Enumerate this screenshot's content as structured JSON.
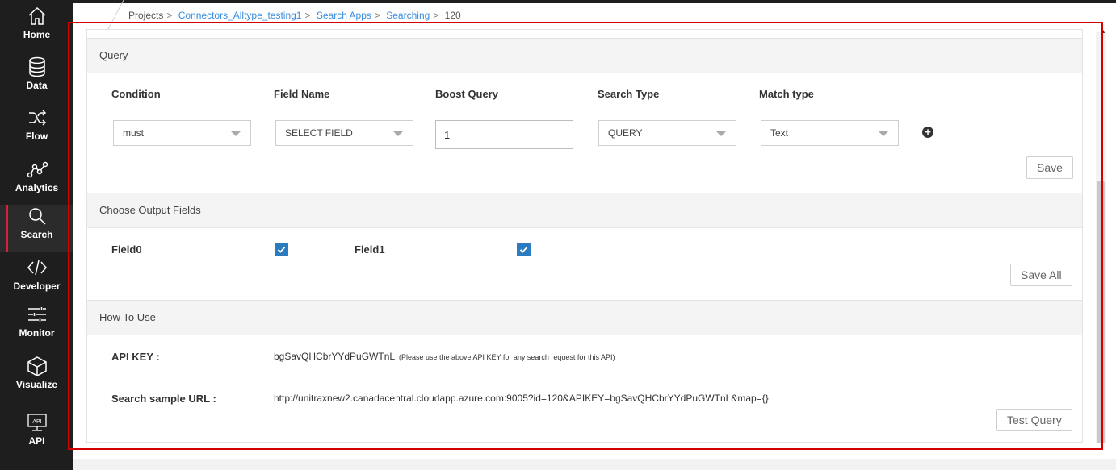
{
  "sidebar": {
    "items": [
      {
        "label": "Home",
        "icon": "home-icon"
      },
      {
        "label": "Data",
        "icon": "database-icon"
      },
      {
        "label": "Flow",
        "icon": "shuffle-icon"
      },
      {
        "label": "Analytics",
        "icon": "analytics-icon"
      },
      {
        "label": "Search",
        "icon": "search-icon",
        "active": true
      },
      {
        "label": "Developer",
        "icon": "code-icon"
      },
      {
        "label": "Monitor",
        "icon": "sliders-icon"
      },
      {
        "label": "Visualize",
        "icon": "cube-icon"
      },
      {
        "label": "API",
        "icon": "api-icon"
      }
    ],
    "accent_color": "#d6203f"
  },
  "breadcrumb": {
    "root": "Projects",
    "project": "Connectors_Alltype_testing1",
    "apps": "Search Apps",
    "section": "Searching",
    "current": "120",
    "separator": ">"
  },
  "query": {
    "title": "Query",
    "columns": {
      "condition": "Condition",
      "field_name": "Field Name",
      "boost_query": "Boost Query",
      "search_type": "Search Type",
      "match_type": "Match type"
    },
    "values": {
      "condition": "must",
      "field_name": "SELECT FIELD",
      "boost_query": "1",
      "search_type": "QUERY",
      "match_type": "Text"
    },
    "save_label": "Save"
  },
  "output_fields": {
    "title": "Choose Output Fields",
    "fields": [
      {
        "name": "Field0",
        "checked": true
      },
      {
        "name": "Field1",
        "checked": true
      }
    ],
    "save_all_label": "Save All"
  },
  "how_to_use": {
    "title": "How To Use",
    "api_key_label": "API KEY :",
    "api_key_value": "bgSavQHCbrYYdPuGWTnL",
    "api_key_note": "(Please use the above API KEY for any search request for this API)",
    "url_label": "Search sample URL :",
    "url_value": "http://unitraxnew2.canadacentral.cloudapp.azure.com:9005?id=120&APIKEY=bgSavQHCbrYYdPuGWTnL&map={}",
    "test_label": "Test Query"
  },
  "colors": {
    "checkbox": "#2a7bbf",
    "link": "#3a8dde",
    "highlight": "#d40000"
  }
}
